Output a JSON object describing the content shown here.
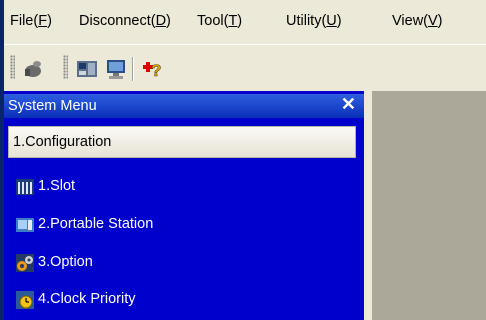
{
  "menubar": {
    "items": [
      {
        "text": "File(",
        "key": "F",
        "close": ")"
      },
      {
        "text": "Disconnect(",
        "key": "D",
        "close": ")"
      },
      {
        "text": "Tool(",
        "key": "T",
        "close": ")"
      },
      {
        "text": "Utility(",
        "key": "U",
        "close": ")"
      },
      {
        "text": "View(",
        "key": "V",
        "close": ")"
      }
    ]
  },
  "toolbar": {
    "icons": [
      "connect-icon",
      "station-icon",
      "monitor-icon",
      "help-icon"
    ]
  },
  "panel": {
    "title": "System Menu",
    "close_glyph": "✕",
    "group": "1.Configuration",
    "items": [
      {
        "label": "1.Slot",
        "icon": "slot-icon"
      },
      {
        "label": "2.Portable Station",
        "icon": "portable-station-icon"
      },
      {
        "label": "3.Option",
        "icon": "option-icon"
      },
      {
        "label": "4.Clock Priority",
        "icon": "clock-priority-icon"
      }
    ]
  }
}
